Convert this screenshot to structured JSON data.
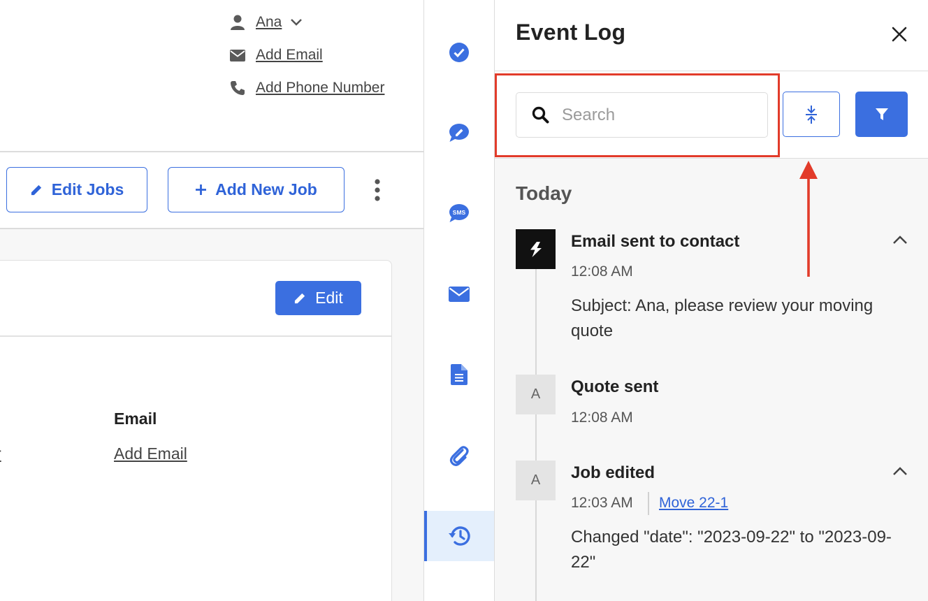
{
  "contact": {
    "name": "Ana",
    "add_email": "Add Email",
    "add_phone": "Add Phone Number"
  },
  "job_actions": {
    "edit_jobs": "Edit Jobs",
    "add_new_job": "Add New Job"
  },
  "card": {
    "edit_label": "Edit",
    "email_heading": "Email",
    "add_email_link": "Add Email",
    "clipped_link_fragment": "r"
  },
  "rail": {
    "items": [
      "check-circle-icon",
      "chat-edit-icon",
      "sms-icon",
      "envelope-icon",
      "document-icon",
      "paperclip-icon",
      "history-icon"
    ],
    "active": "history-icon"
  },
  "event_log": {
    "title": "Event Log",
    "search_placeholder": "Search",
    "section": "Today",
    "events": [
      {
        "avatar": "",
        "title": "Email sent to contact",
        "time": "12:08 AM",
        "body": "Subject: Ana, please review your moving quote"
      },
      {
        "avatar": "A",
        "title": "Quote sent",
        "time": "12:08 AM"
      },
      {
        "avatar": "A",
        "title": "Job edited",
        "time": "12:03 AM",
        "link": "Move 22-1",
        "body": "Changed \"date\": \"2023-09-22\" to \"2023-09-22\""
      }
    ]
  },
  "colors": {
    "accent": "#3b6fe0",
    "annotation": "#e23b2a",
    "panel_bg": "#f7f7f7"
  }
}
